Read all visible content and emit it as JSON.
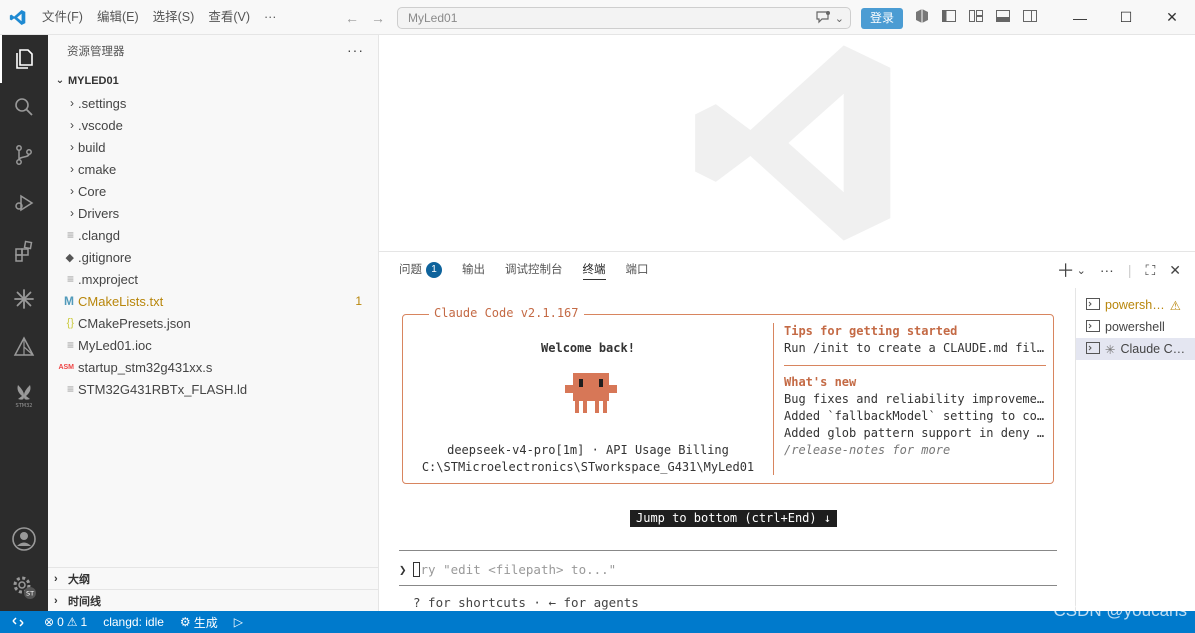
{
  "titlebar": {
    "menu": [
      "文件(F)",
      "编辑(E)",
      "选择(S)",
      "查看(V)",
      "···"
    ],
    "search_text": "MyLed01",
    "login_label": "登录"
  },
  "sidebar": {
    "title": "资源管理器",
    "more": "···",
    "root": "MYLED01",
    "items": [
      {
        "label": ".settings",
        "type": "folder"
      },
      {
        "label": ".vscode",
        "type": "folder"
      },
      {
        "label": "build",
        "type": "folder"
      },
      {
        "label": "cmake",
        "type": "folder"
      },
      {
        "label": "Core",
        "type": "folder"
      },
      {
        "label": "Drivers",
        "type": "folder"
      },
      {
        "label": ".clangd",
        "type": "file"
      },
      {
        "label": ".gitignore",
        "type": "git"
      },
      {
        "label": ".mxproject",
        "type": "file"
      },
      {
        "label": "CMakeLists.txt",
        "type": "cmake",
        "badge": "1"
      },
      {
        "label": "CMakePresets.json",
        "type": "json"
      },
      {
        "label": "MyLed01.ioc",
        "type": "file"
      },
      {
        "label": "startup_stm32g431xx.s",
        "type": "asm"
      },
      {
        "label": "STM32G431RBTx_FLASH.ld",
        "type": "file"
      }
    ],
    "outline": "大纲",
    "timeline": "时间线"
  },
  "panel": {
    "tabs": [
      {
        "label": "问题",
        "badge": "1"
      },
      {
        "label": "输出"
      },
      {
        "label": "调试控制台"
      },
      {
        "label": "终端",
        "active": true
      },
      {
        "label": "端口"
      }
    ]
  },
  "terminal": {
    "box_title": "Claude Code v2.1.167",
    "welcome": "Welcome back!",
    "model_line": "deepseek-v4-pro[1m] · API Usage Billing",
    "path_line": "C:\\STMicroelectronics\\STworkspace_G431\\MyLed01",
    "tips_heading": "Tips for getting started",
    "tips_line": "Run /init to create a CLAUDE.md file…",
    "new_heading": "What's new",
    "new_lines": [
      "Bug fixes and reliability improvemen…",
      "Added `fallbackModel` setting to con…",
      "Added glob pattern support in deny r…"
    ],
    "release_notes": "/release-notes for more",
    "jump": "Jump to bottom (ctrl+End) ↓",
    "prompt_symbol": "❯",
    "placeholder": "ry \"edit <filepath> to...\"",
    "hint": "? for shortcuts · ← for agents"
  },
  "terminal_list": [
    {
      "label": "powersh…",
      "warn": true
    },
    {
      "label": "powershell"
    },
    {
      "label": "Claude C…",
      "active": true
    }
  ],
  "statusbar": {
    "errors": "0",
    "warnings": "1",
    "clangd": "clangd: idle",
    "build": "生成"
  },
  "watermark": "CSDN @youcans",
  "colors": {
    "accent": "#007acc",
    "claude": "#c46a45",
    "mascot": "#d77757"
  }
}
